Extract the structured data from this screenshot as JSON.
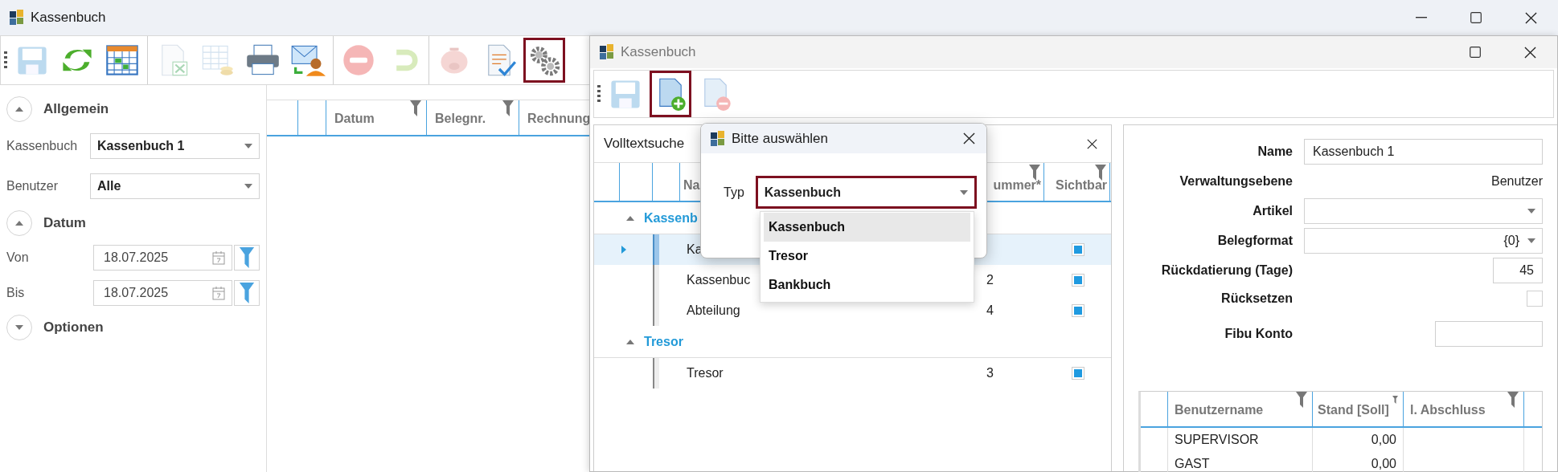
{
  "main_window": {
    "title": "Kassenbuch"
  },
  "main_toolbar": [
    {
      "buttons": [
        {
          "disabled": true,
          "highlighted": false
        },
        {
          "disabled": false,
          "highlighted": false
        },
        {
          "disabled": false,
          "highlighted": false
        }
      ]
    },
    {
      "buttons": [
        {
          "disabled": true,
          "highlighted": false
        },
        {
          "disabled": true,
          "highlighted": false
        },
        {
          "disabled": false,
          "highlighted": false
        },
        {
          "disabled": false,
          "highlighted": false
        }
      ]
    },
    {
      "buttons": [
        {
          "disabled": true,
          "highlighted": false
        },
        {
          "disabled": true,
          "highlighted": false
        }
      ]
    },
    {
      "buttons": [
        {
          "disabled": true,
          "highlighted": false
        },
        {
          "disabled": false,
          "highlighted": false
        },
        {
          "disabled": false,
          "highlighted": true
        }
      ]
    }
  ],
  "filter_panel": {
    "sections": [
      {
        "title": "Allgemein",
        "expanded": true,
        "fields": [
          {
            "kind": "combo",
            "label": "Kassenbuch",
            "value": "Kassenbuch 1"
          },
          {
            "kind": "combo",
            "label": "Benutzer",
            "value": "Alle"
          }
        ]
      },
      {
        "title": "Datum",
        "expanded": true,
        "fields": [
          {
            "kind": "date",
            "label": "Von",
            "value": "18.07.2025"
          },
          {
            "kind": "date",
            "label": "Bis",
            "value": "18.07.2025"
          }
        ]
      },
      {
        "title": "Optionen",
        "expanded": false
      }
    ]
  },
  "journal_table": {
    "columns": [
      {
        "label": "Datum",
        "filter": true
      },
      {
        "label": "Belegnr.",
        "filter": true
      },
      {
        "label": "Rechnung"
      }
    ]
  },
  "settings_window": {
    "title": "Kassenbuch",
    "toolbar": [
      {
        "disabled": true,
        "highlighted": false
      },
      {
        "disabled": false,
        "highlighted": true
      },
      {
        "disabled": true,
        "highlighted": false
      }
    ],
    "search": {
      "title": "Volltextsuche"
    },
    "table": {
      "columns": [
        {
          "label": "Na"
        },
        {
          "label": "ummer*",
          "filter": true
        },
        {
          "label": "Sichtbar",
          "filter": true
        }
      ],
      "groups": [
        {
          "name": "Kassenb",
          "expanded": true,
          "rows": [
            {
              "name": "Ka",
              "selected": true,
              "visible": true
            },
            {
              "name": "Kassenbuc",
              "number": "2",
              "selected": false,
              "visible": true
            },
            {
              "name": "Abteilung",
              "number": "4",
              "selected": false,
              "visible": true
            }
          ]
        },
        {
          "name": "Tresor",
          "expanded": true,
          "rows": [
            {
              "name": "Tresor",
              "number": "3",
              "selected": false,
              "visible": true
            }
          ]
        }
      ]
    },
    "properties": [
      {
        "kind": "text",
        "label": "Name",
        "value": "Kassenbuch 1"
      },
      {
        "kind": "readonly",
        "label": "Verwaltungsebene",
        "value": "Benutzer"
      },
      {
        "kind": "combo",
        "label": "Artikel"
      },
      {
        "kind": "combo",
        "label": "Belegformat",
        "value": "{0}"
      },
      {
        "kind": "number",
        "label": "Rückdatierung (Tage)",
        "value": "45"
      },
      {
        "kind": "checkbox",
        "label": "Rücksetzen",
        "checked": false
      },
      {
        "kind": "short_text",
        "label": "Fibu Konto"
      }
    ],
    "user_table": {
      "columns": [
        {
          "label": "Benutzername",
          "filter": true
        },
        {
          "label": "Stand [Soll]",
          "filter": true
        },
        {
          "label": "l. Abschluss",
          "filter": true
        }
      ],
      "rows": [
        {
          "user": "SUPERVISOR",
          "balance": "0,00"
        },
        {
          "user": "GAST",
          "balance": "0,00"
        }
      ]
    }
  },
  "dialog": {
    "title": "Bitte auswählen",
    "field_label": "Typ",
    "value": "Kassenbuch",
    "highlighted": true,
    "open": true,
    "options": [
      {
        "label": "Kassenbuch",
        "selected": true
      },
      {
        "label": "Tresor",
        "selected": false
      },
      {
        "label": "Bankbuch",
        "selected": false
      }
    ]
  }
}
